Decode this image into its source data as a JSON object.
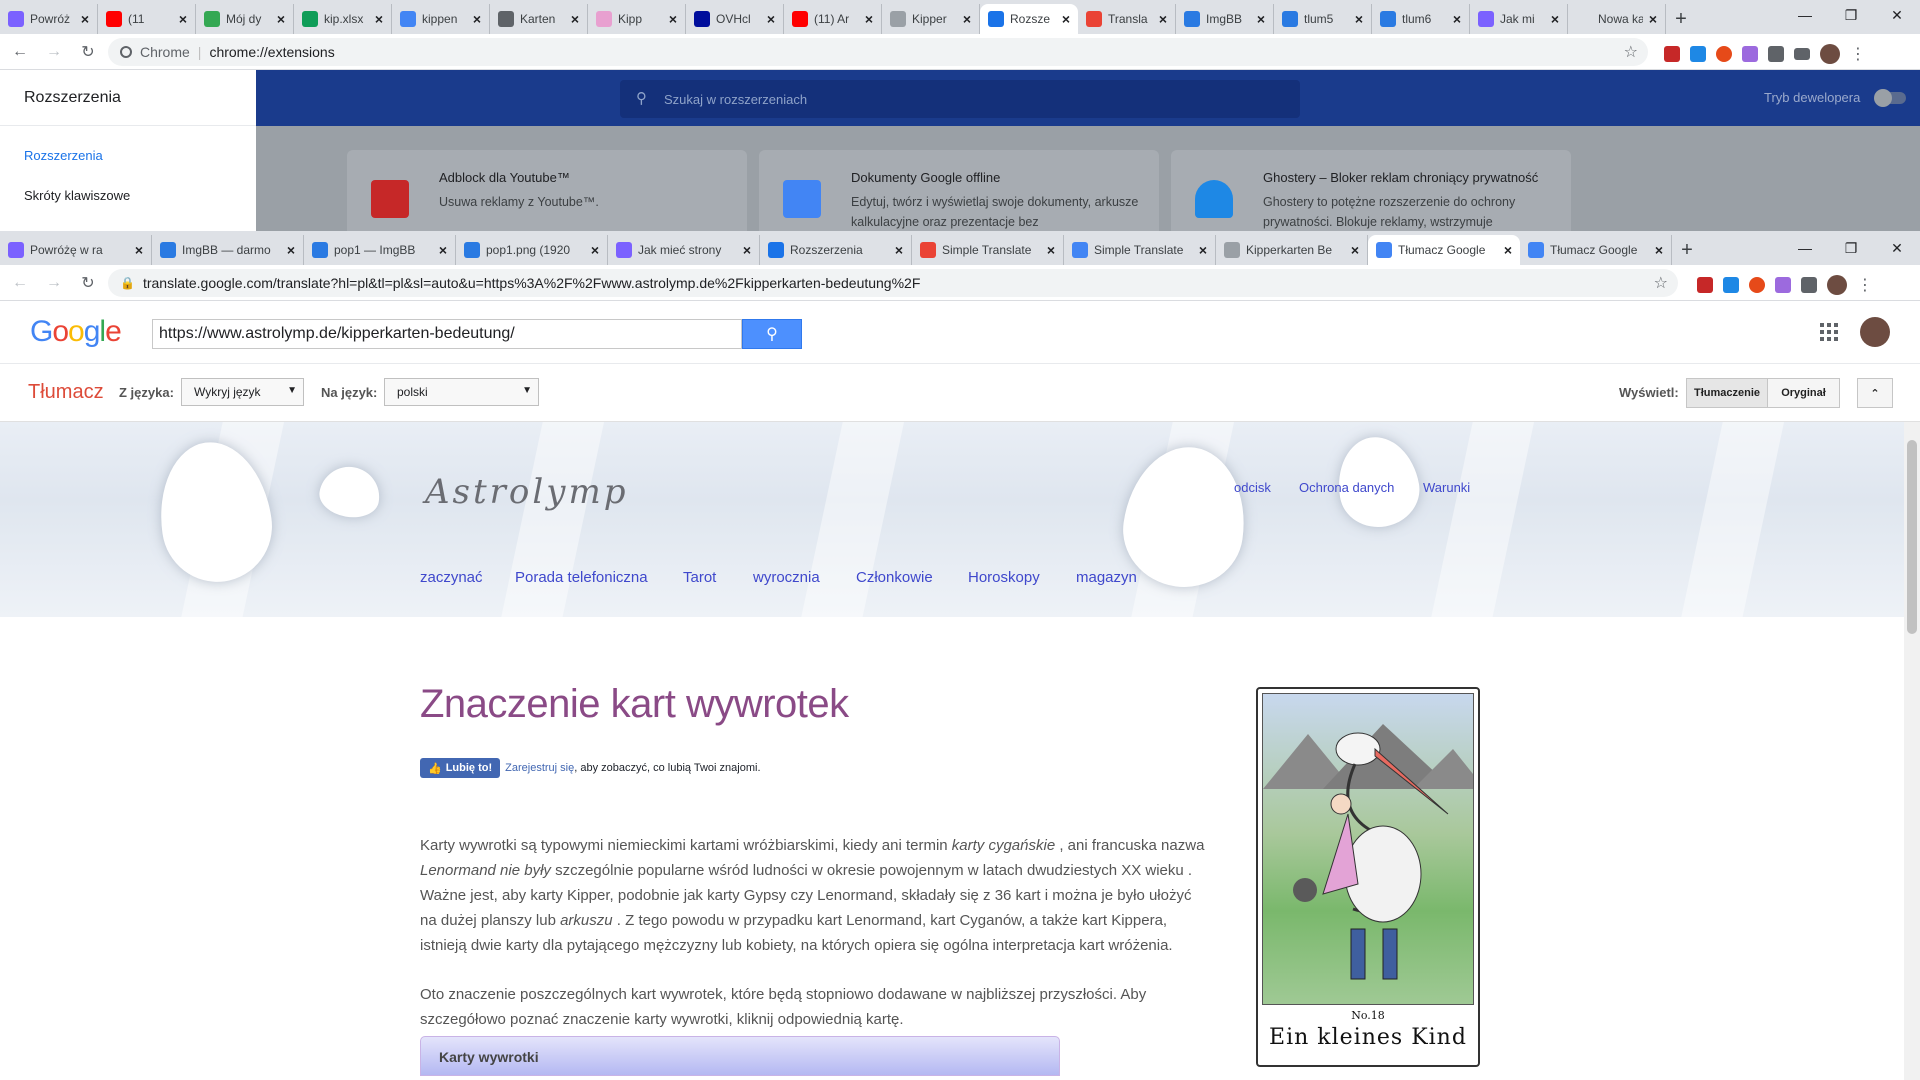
{
  "window1": {
    "tabs": [
      {
        "label": "Powróż",
        "color": "#7b61ff"
      },
      {
        "label": "(11",
        "color": "#ff0000"
      },
      {
        "label": "Mój dy",
        "color": "#34a853"
      },
      {
        "label": "kip.xlsx",
        "color": "#0f9d58"
      },
      {
        "label": "kippen",
        "color": "#4285f4"
      },
      {
        "label": "Karten",
        "color": "#5f6368"
      },
      {
        "label": "Kipp",
        "color": "#e8a0d0"
      },
      {
        "label": "OVHcl",
        "color": "#000e9c"
      },
      {
        "label": "(11) Ar",
        "color": "#ff0000"
      },
      {
        "label": "Kipper",
        "color": "#9aa0a6"
      },
      {
        "label": "Rozsze",
        "color": "#1a73e8"
      },
      {
        "label": "Transla",
        "color": "#ea4335"
      },
      {
        "label": "ImgBB",
        "color": "#2a7ae2"
      },
      {
        "label": "tlum5",
        "color": "#2a7ae2"
      },
      {
        "label": "tlum6",
        "color": "#2a7ae2"
      },
      {
        "label": "Jak mi",
        "color": "#7b61ff"
      },
      {
        "label": "Nowa karta",
        "color": "#dee1e6"
      }
    ],
    "active_tab_index": 10,
    "omnibox_prefix": "Chrome",
    "url": "chrome://extensions"
  },
  "extensions_page": {
    "sidebar_title": "Rozszerzenia",
    "sidebar_items": [
      "Rozszerzenia",
      "Skróty klawiszowe"
    ],
    "search_placeholder": "Szukaj w rozszerzeniach",
    "dev_mode_label": "Tryb dewelopera",
    "cards": [
      {
        "title": "Adblock dla Youtube™",
        "desc": "Usuwa reklamy z Youtube™.",
        "icon_color": "#c62828"
      },
      {
        "title": "Dokumenty Google offline",
        "desc": "Edytuj, twórz i wyświetlaj swoje dokumenty, arkusze kalkulacyjne oraz prezentacje bez",
        "icon_color": "#4285f4"
      },
      {
        "title": "Ghostery – Bloker reklam chroniący prywatność",
        "desc": "Ghostery to potężne rozszerzenie do ochrony prywatności. Blokuje reklamy, wstrzymuje",
        "icon_color": "#1e88e5"
      }
    ]
  },
  "window2": {
    "tabs": [
      {
        "label": "Powróżę w ra",
        "color": "#7b61ff"
      },
      {
        "label": "ImgBB — darmo",
        "color": "#2a7ae2"
      },
      {
        "label": "pop1 — ImgBB",
        "color": "#2a7ae2"
      },
      {
        "label": "pop1.png (1920",
        "color": "#2a7ae2"
      },
      {
        "label": "Jak mieć strony",
        "color": "#7b61ff"
      },
      {
        "label": "Rozszerzenia",
        "color": "#1a73e8"
      },
      {
        "label": "Simple Translate",
        "color": "#ea4335"
      },
      {
        "label": "Simple Translate",
        "color": "#4285f4"
      },
      {
        "label": "Kipperkarten Be",
        "color": "#9aa0a6"
      },
      {
        "label": "Tłumacz Google",
        "color": "#4285f4"
      },
      {
        "label": "Tłumacz Google",
        "color": "#4285f4"
      }
    ],
    "active_tab_index": 9,
    "url": "translate.google.com/translate?hl=pl&tl=pl&sl=auto&u=https%3A%2F%2Fwww.astrolymp.de%2Fkipperkarten-bedeutung%2F"
  },
  "google_bar": {
    "logo": "Google",
    "search_value": "https://www.astrolymp.de/kipperkarten-bedeutung/"
  },
  "translate_bar": {
    "title": "Tłumacz",
    "from_label": "Z języka:",
    "from_value": "Wykryj język",
    "to_label": "Na język:",
    "to_value": "polski",
    "view_label": "Wyświetl:",
    "view_translation": "Tłumaczenie",
    "view_original": "Oryginał"
  },
  "site": {
    "logo": "Astrolymp",
    "top_links": [
      "odcisk",
      "Ochrona danych",
      "Warunki"
    ],
    "main_nav": [
      "zaczynać",
      "Porada telefoniczna",
      "Tarot",
      "wyrocznia",
      "Członkowie",
      "Horoskopy",
      "magazyn"
    ],
    "heading": "Znaczenie kart wywrotek",
    "fb_like": "Lubię to!",
    "fb_signup": "Zarejestruj się",
    "fb_text": ", aby zobaczyć, co lubią Twoi znajomi.",
    "para1_parts": {
      "a": "Karty wywrotki są typowymi niemieckimi kartami wróżbiarskimi, kiedy ani termin ",
      "b": "karty cygańskie",
      "c": " , ani francuska nazwa ",
      "d": "Lenormand nie były",
      "e": " szczególnie popularne wśród ludności w okresie powojennym w latach dwudziestych XX wieku . Ważne jest, aby karty Kipper, podobnie jak karty Gypsy czy Lenormand, składały się z 36 kart i można je było ułożyć na dużej planszy lub ",
      "f": "arkuszu",
      "g": " . Z tego powodu w przypadku kart Lenormand, kart Cyganów, a także kart Kippera, istnieją dwie karty dla pytającego mężczyzny lub kobiety, na których opiera się ogólna interpretacja kart wróżenia."
    },
    "para2": "Oto znaczenie poszczególnych kart wywrotek, które będą stopniowo dodawane w najbliższej przyszłości. Aby szczegółowo poznać znaczenie karty wywrotki, kliknij odpowiednią kartę.",
    "box_title": "Karty wywrotki",
    "card_number": "No.18",
    "card_name": "Ein kleines Kind"
  }
}
